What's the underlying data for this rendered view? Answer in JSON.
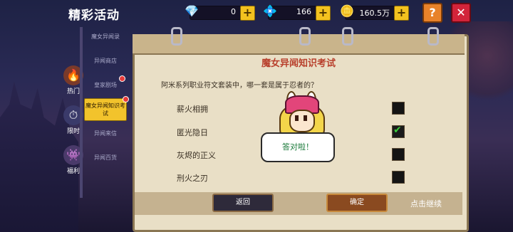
{
  "header": {
    "title": "精彩活动"
  },
  "resources": [
    {
      "icon": "💎",
      "value": "0"
    },
    {
      "icon": "💠",
      "value": "166"
    },
    {
      "icon": "🪙",
      "value": "160.5万"
    }
  ],
  "buttons": {
    "help": "?",
    "close": "✕"
  },
  "categories": [
    {
      "icon": "🔥",
      "label": "热门"
    },
    {
      "icon": "⏱",
      "label": "限时"
    },
    {
      "icon": "👾",
      "label": "福利"
    }
  ],
  "subitems": [
    {
      "label": "魔女异闻录"
    },
    {
      "label": "异闻商店"
    },
    {
      "label": "皇家剧场"
    },
    {
      "label": "魔女异闻知识考试"
    },
    {
      "label": "异闻来信"
    },
    {
      "label": "异闻百货"
    }
  ],
  "quiz": {
    "title": "魔女异闻知识考试",
    "question": "阿米系列职业符文套装中，哪一套是属于忍者的？",
    "options": [
      {
        "label": "薪火相拥",
        "checked": false
      },
      {
        "label": "匿光隐日",
        "checked": true
      },
      {
        "label": "灰烬的正义",
        "checked": false
      },
      {
        "label": "刑火之刃",
        "checked": false
      }
    ],
    "back_label": "返回",
    "confirm_label": "确定"
  },
  "feedback": {
    "message": "答对啦！"
  },
  "continue_label": "点击继续"
}
